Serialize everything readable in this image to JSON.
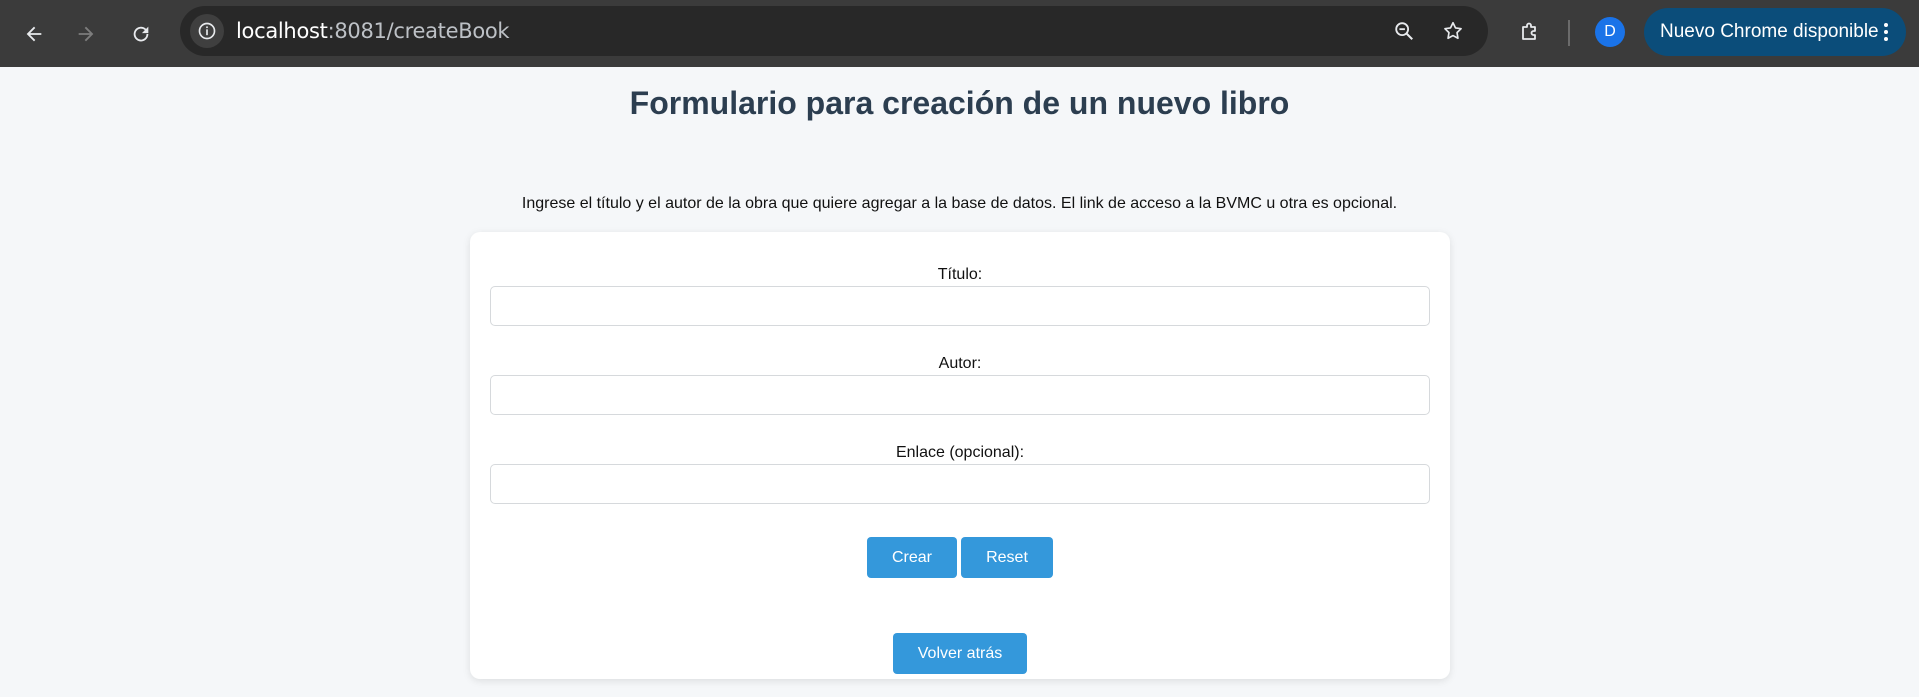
{
  "browser": {
    "url_host": "localhost",
    "url_path": ":8081/createBook",
    "profile_initial": "D",
    "update_label": "Nuevo Chrome disponible",
    "icons": [
      "arrow-left-icon",
      "arrow-right-icon",
      "reload-icon",
      "info-icon",
      "zoom-out-icon",
      "star-icon",
      "extensions-icon",
      "kebab-icon"
    ]
  },
  "page": {
    "title": "Formulario para creación de un nuevo libro",
    "instructions": "Ingrese el título y el autor de la obra que quiere agregar a la base de datos. El link de acceso a la BVMC u otra es opcional."
  },
  "form": {
    "titulo_label": "Título:",
    "titulo_value": "",
    "autor_label": "Autor:",
    "autor_value": "",
    "enlace_label": "Enlace (opcional):",
    "enlace_value": "",
    "crear_label": "Crear",
    "reset_label": "Reset"
  },
  "back_label": "Volver atrás",
  "colors": {
    "accent": "#3498db",
    "title": "#2c3e50",
    "page_bg": "#f5f7f9",
    "toolbar_bg": "#3b3b3b",
    "update_pill": "#0b4d7a"
  }
}
